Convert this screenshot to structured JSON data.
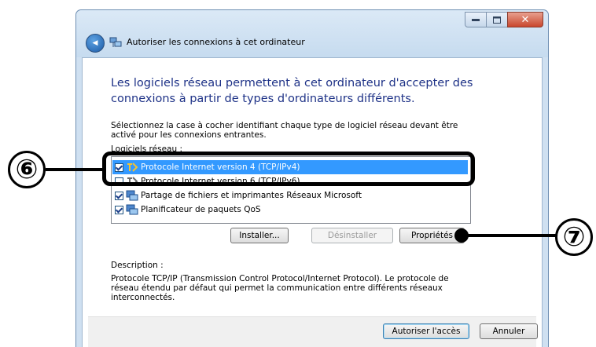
{
  "window": {
    "title": "Autoriser les connexions à cet ordinateur",
    "buttons": {
      "minimize": "—",
      "maximize": "□",
      "close": "✕"
    },
    "back_glyph": "◀"
  },
  "heading": "Les logiciels réseau permettent à cet ordinateur d'accepter des connexions à partir de types d'ordinateurs différents.",
  "instructions": "Sélectionnez la case à cocher identifiant chaque type de logiciel réseau devant être activé pour les connexions entrantes.",
  "list": {
    "label": "Logiciels réseau :",
    "items": [
      {
        "label": "Protocole Internet version 4 (TCP/IPv4)",
        "checked": true,
        "selected": true,
        "icon": "network-protocol-icon"
      },
      {
        "label": "Protocole Internet version 6 (TCP/IPv6)",
        "checked": false,
        "selected": false,
        "icon": "network-protocol-icon"
      },
      {
        "label": "Partage de fichiers et imprimantes Réseaux Microsoft",
        "checked": true,
        "selected": false,
        "icon": "network-service-icon"
      },
      {
        "label": "Planificateur de paquets QoS",
        "checked": true,
        "selected": false,
        "icon": "network-service-icon"
      }
    ]
  },
  "actions": {
    "install": "Installer...",
    "uninstall": "Désinstaller",
    "properties": "Propriétés"
  },
  "description": {
    "label": "Description :",
    "text": "Protocole TCP/IP (Transmission Control Protocol/Internet Protocol). Le protocole de réseau étendu par défaut qui permet la communication entre différents réseaux interconnectés."
  },
  "footer": {
    "allow": "Autoriser l'accès",
    "cancel": "Annuler"
  },
  "annotations": {
    "marker6": "⑥",
    "marker7": "⑦"
  },
  "colors": {
    "heading": "#1e3287",
    "selection": "#3399ff"
  }
}
